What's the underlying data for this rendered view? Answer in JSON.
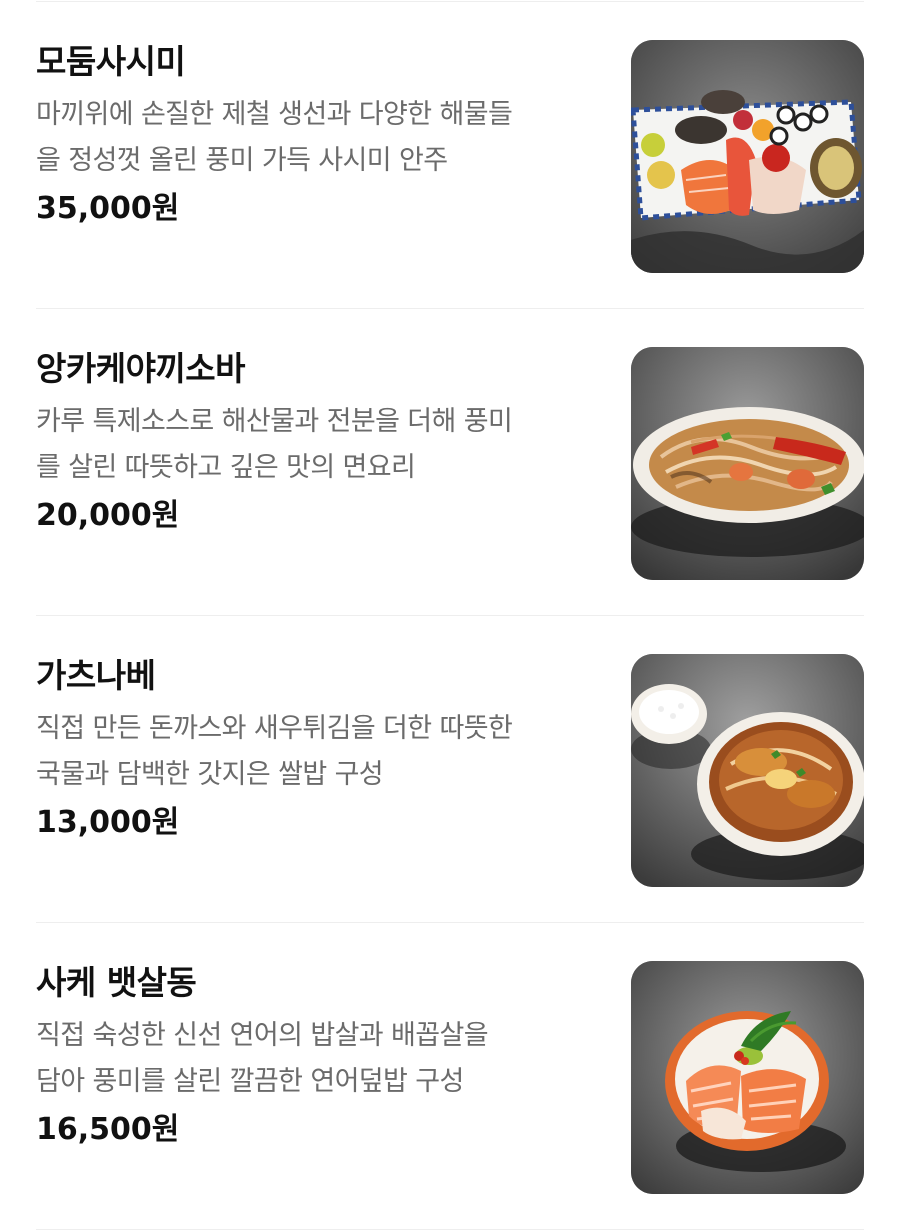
{
  "menu": {
    "items": [
      {
        "name": "모둠사시미",
        "desc_line1": "마끼위에 손질한 제철 생선과 다양한 해물들",
        "desc_line2": "을 정성껏 올린 풍미 가득 사시미 안주",
        "price": "35,000원"
      },
      {
        "name": "앙카케야끼소바",
        "desc_line1": "카루 특제소스로 해산물과 전분을 더해 풍미",
        "desc_line2": "를 살린 따뜻하고 깊은 맛의 면요리",
        "price": "20,000원"
      },
      {
        "name": "가츠나베",
        "desc_line1": "직접 만든 돈까스와 새우튀김을 더한 따뜻한",
        "desc_line2": "국물과 담백한 갓지은 쌀밥 구성",
        "price": "13,000원"
      },
      {
        "name": "사케 뱃살동",
        "desc_line1": "직접 숙성한 신선 연어의 밥살과 배꼽살을",
        "desc_line2": "담아 풍미를 살린 깔끔한 연어덮밥 구성",
        "price": "16,500원"
      }
    ]
  }
}
